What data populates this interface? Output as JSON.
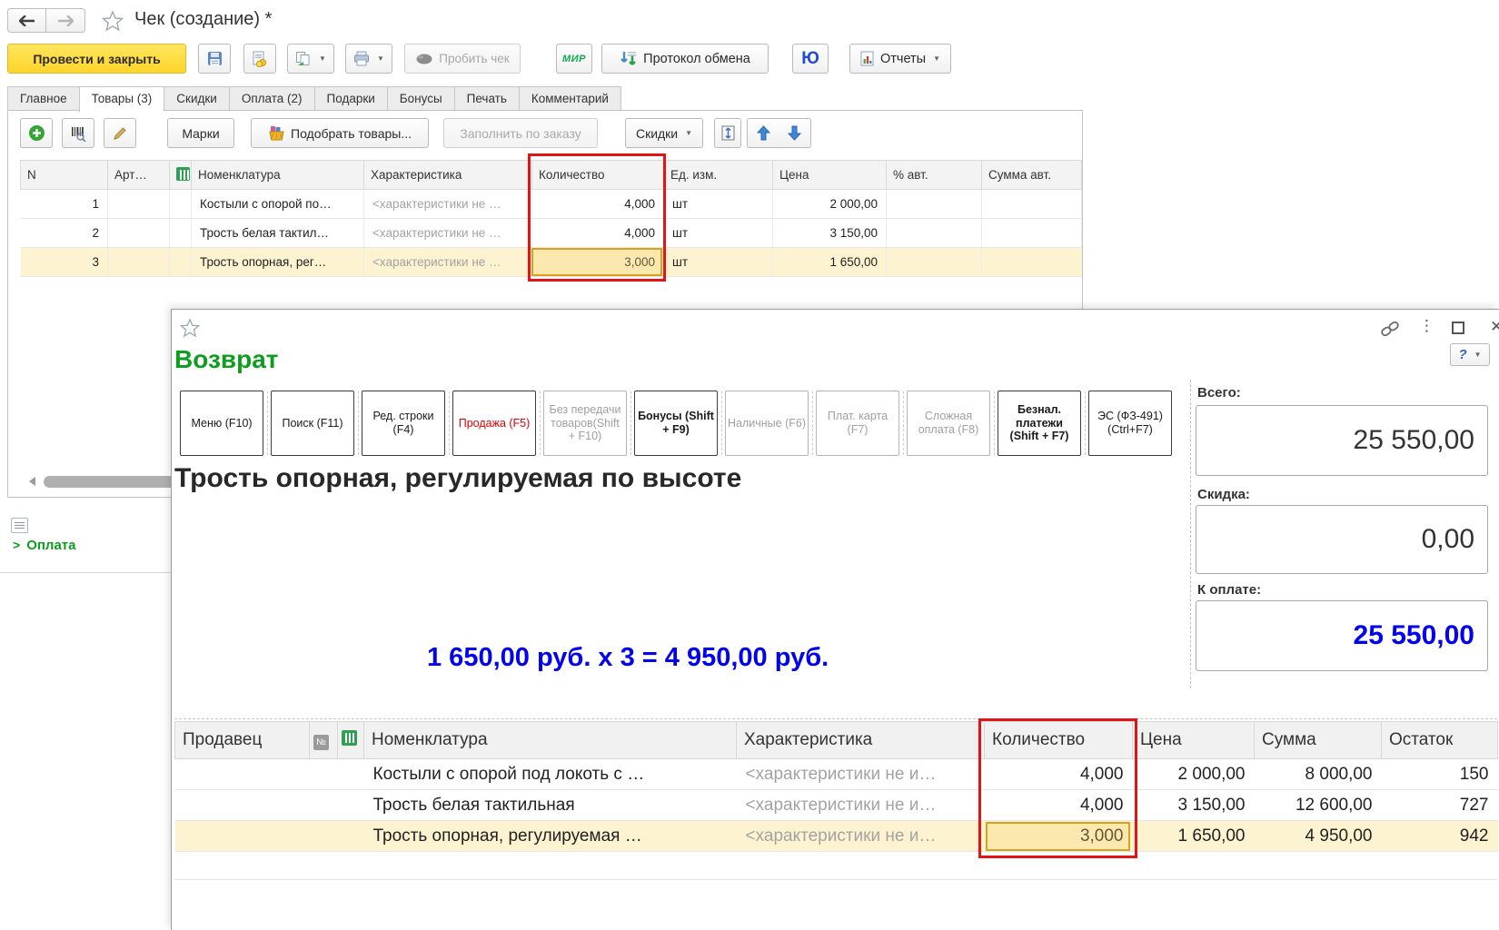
{
  "receipt": {
    "title": "Чек (создание) *",
    "toolbar": {
      "post_and_close": "Провести и закрыть",
      "fiscal_print": "Пробить чек",
      "mir": "МИР",
      "protocol": "Протокол обмена",
      "yumoney": "Ю",
      "reports": "Отчеты"
    },
    "tabs": [
      {
        "label": "Главное"
      },
      {
        "label": "Товары (3)"
      },
      {
        "label": "Скидки"
      },
      {
        "label": "Оплата (2)"
      },
      {
        "label": "Подарки"
      },
      {
        "label": "Бонусы"
      },
      {
        "label": "Печать"
      },
      {
        "label": "Комментарий"
      }
    ],
    "cmdbar": {
      "marks": "Марки",
      "pick_goods": "Подобрать товары...",
      "fill_by_order": "Заполнить по заказу",
      "discounts": "Скидки"
    },
    "table": {
      "columns": [
        "N",
        "Арт…",
        "",
        "Номенклатура",
        "Характеристика",
        "Количество",
        "Ед. изм.",
        "Цена",
        "% авт.",
        "Сумма авт."
      ],
      "rows": [
        {
          "n": "1",
          "art": "",
          "name": "Костыли с опорой по…",
          "characteristic": "<характеристики не …",
          "qty": "4,000",
          "unit": "шт",
          "price": "2 000,00",
          "pct_auto": "",
          "sum_auto": ""
        },
        {
          "n": "2",
          "art": "",
          "name": "Трость белая тактил…",
          "characteristic": "<характеристики не …",
          "qty": "4,000",
          "unit": "шт",
          "price": "3 150,00",
          "pct_auto": "",
          "sum_auto": ""
        },
        {
          "n": "3",
          "art": "",
          "name": "Трость опорная, рег…",
          "characteristic": "<характеристики не …",
          "qty": "3,000",
          "unit": "шт",
          "price": "1 650,00",
          "pct_auto": "",
          "sum_auto": ""
        }
      ]
    },
    "payment_section": {
      "chevron": ">",
      "label": "Оплата"
    }
  },
  "ret": {
    "title": "Возврат",
    "fn_buttons": [
      {
        "label": "Меню (F10)"
      },
      {
        "label": "Поиск (F11)"
      },
      {
        "label": "Ред. строки (F4)"
      },
      {
        "label": "Продажа (F5)"
      },
      {
        "label": "Без передачи товаров(Shift + F10)"
      },
      {
        "label": "Бонусы (Shift + F9)"
      },
      {
        "label": "Наличные (F6)"
      },
      {
        "label": "Плат. карта (F7)"
      },
      {
        "label": "Сложная оплата (F8)"
      },
      {
        "label": "Безнал. платежи (Shift + F7)"
      },
      {
        "label": "ЭС (ФЗ-491) (Ctrl+F7)"
      }
    ],
    "product_title": "Трость опорная, регулируемая по высоте",
    "formula": "1 650,00 руб. х 3  = 4 950,00 руб.",
    "help_label": "?",
    "totals": {
      "total_label": "Всего:",
      "total_value": "25 550,00",
      "discount_label": "Скидка:",
      "discount_value": "0,00",
      "due_label": "К оплате:",
      "due_value": "25 550,00"
    },
    "table": {
      "columns": [
        "Продавец",
        "№",
        "",
        "Номенклатура",
        "Характеристика",
        "Количество",
        "Цена",
        "Сумма",
        "Остаток"
      ],
      "rows": [
        {
          "seller": "",
          "name": "Костыли с опорой под локоть с …",
          "characteristic": "<характеристики не и…",
          "qty": "4,000",
          "price": "2 000,00",
          "sum": "8 000,00",
          "stock": "150"
        },
        {
          "seller": "",
          "name": "Трость белая тактильная",
          "characteristic": "<характеристики не и…",
          "qty": "4,000",
          "price": "3 150,00",
          "sum": "12 600,00",
          "stock": "727"
        },
        {
          "seller": "",
          "name": "Трость опорная, регулируемая …",
          "characteristic": "<характеристики не и…",
          "qty": "3,000",
          "price": "1 650,00",
          "sum": "4 950,00",
          "stock": "942"
        }
      ]
    }
  },
  "colors": {
    "accent_yellow": "#ffd42a",
    "highlight_red": "#e41414",
    "brand_green": "#0f9d20",
    "value_blue": "#0202ee",
    "row_highlight": "#fdf3d0",
    "selected_cell_border": "#d8a11e"
  }
}
